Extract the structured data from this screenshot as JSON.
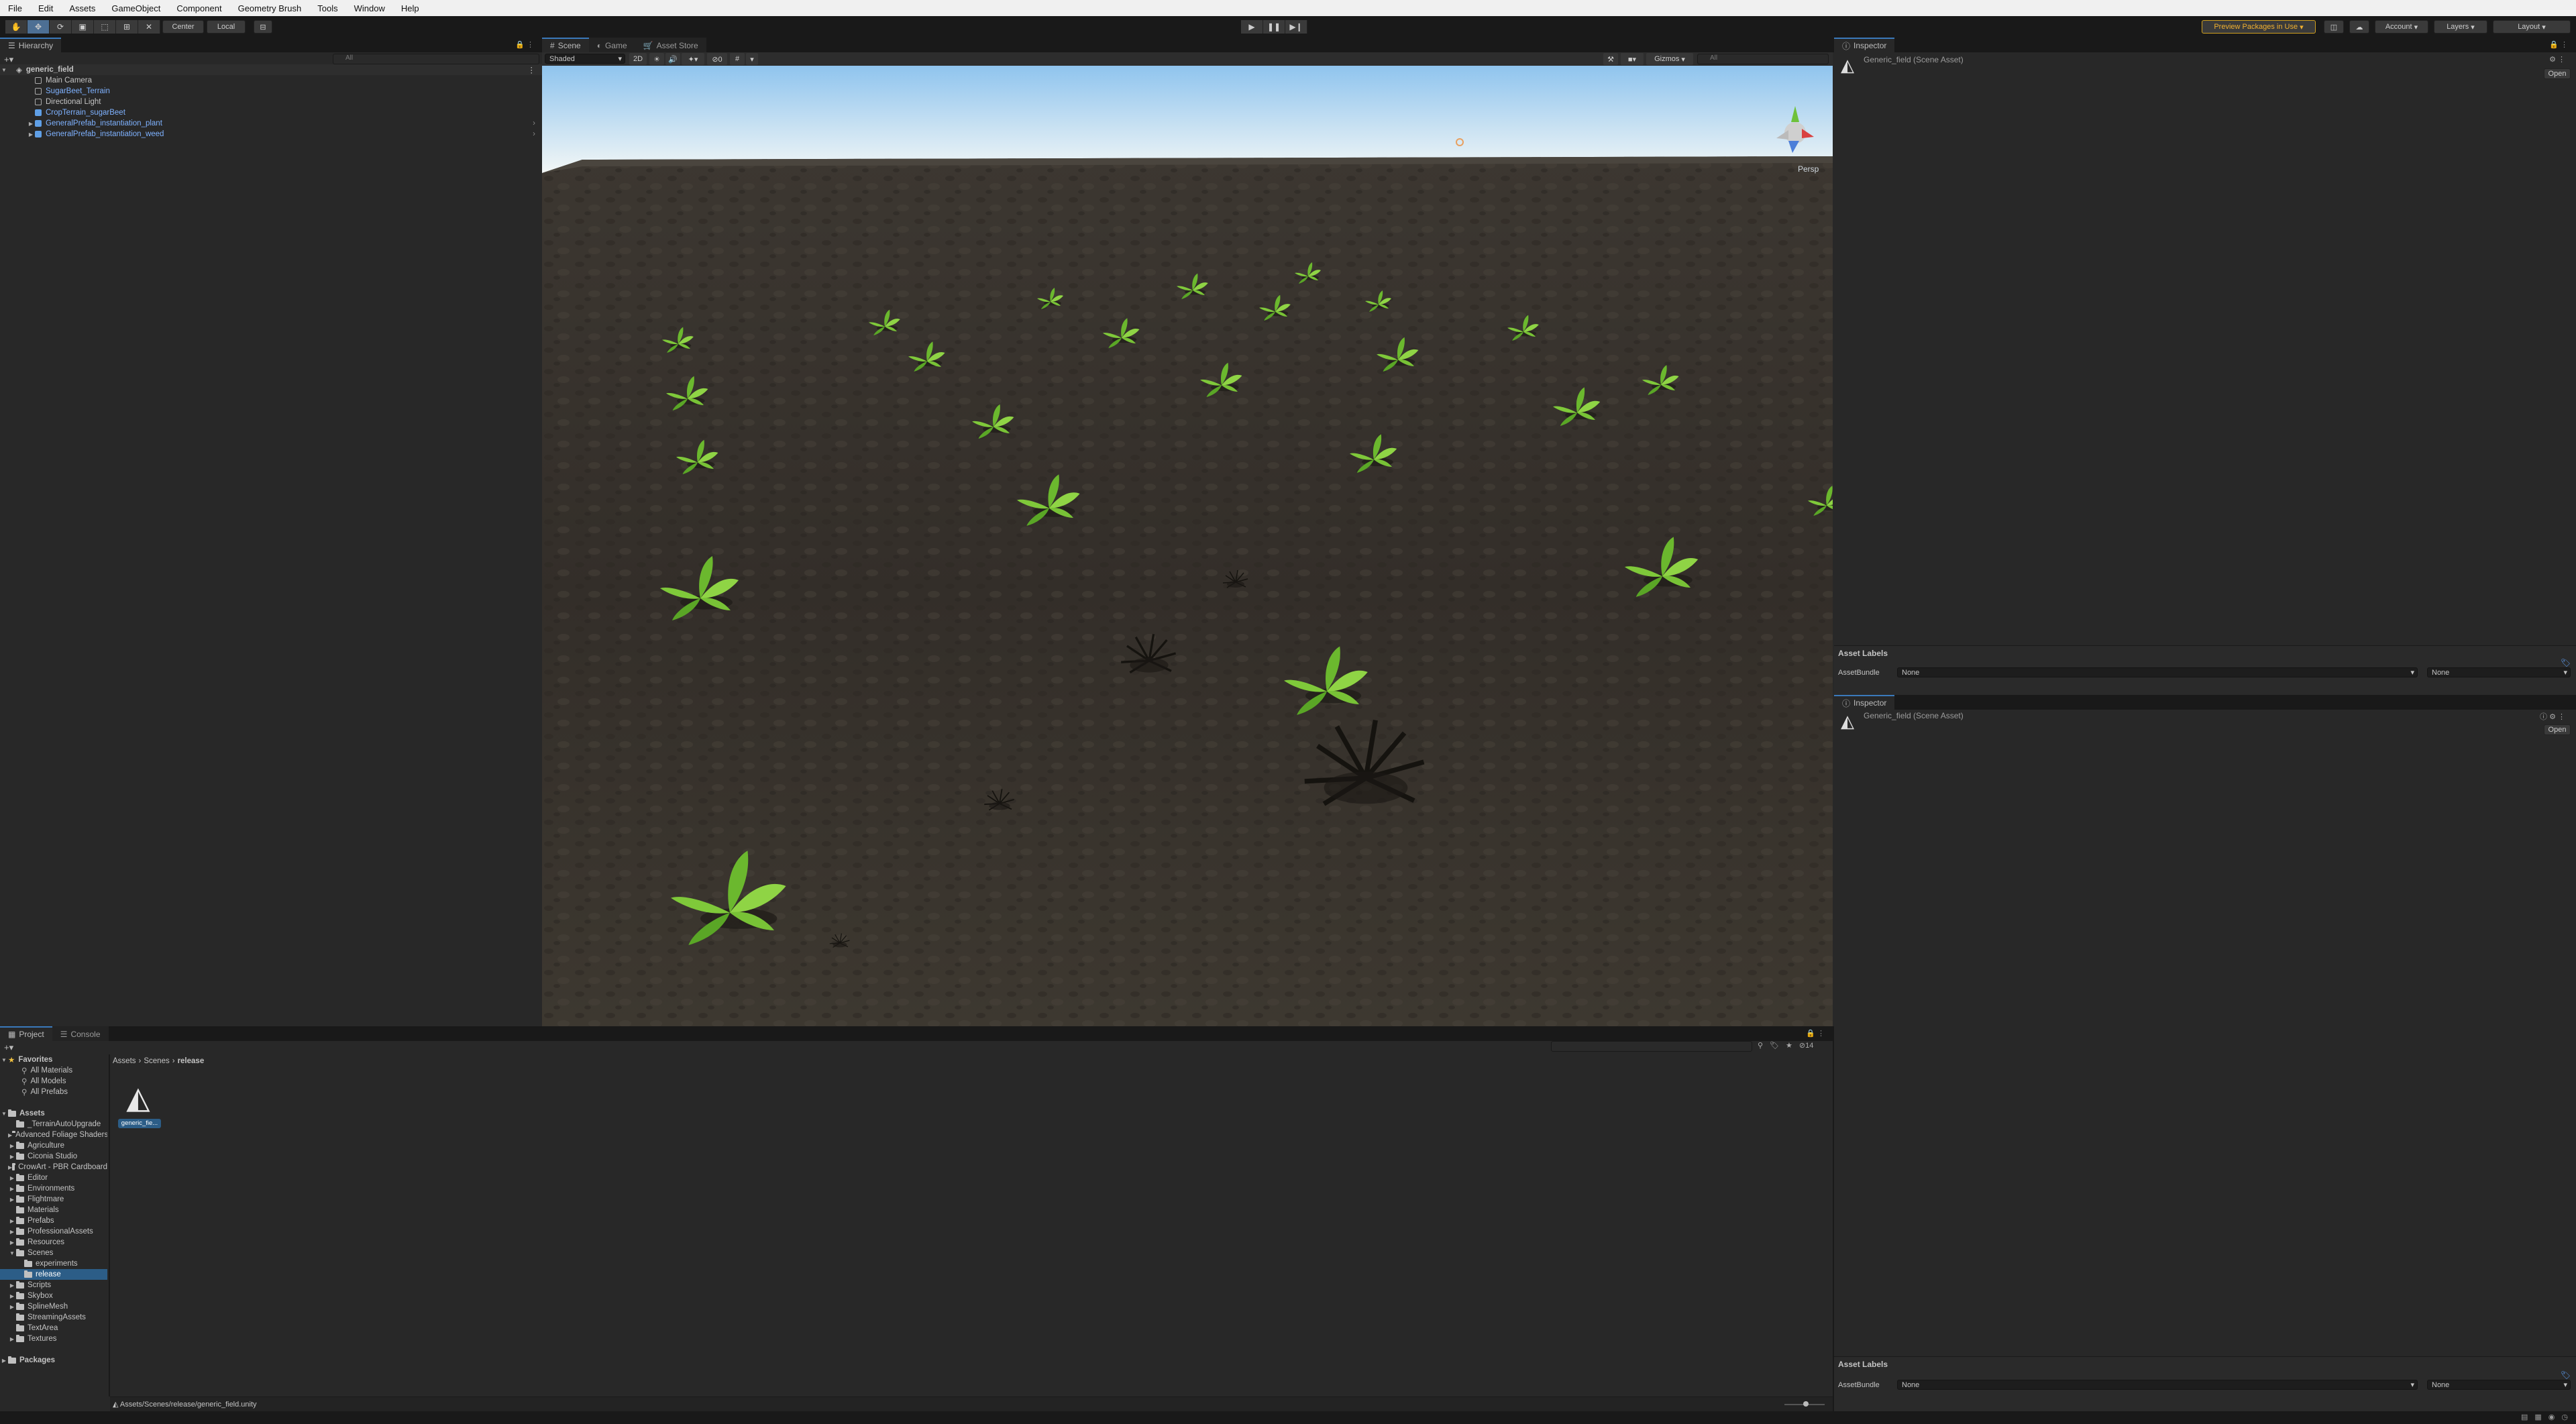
{
  "menubar": [
    "File",
    "Edit",
    "Assets",
    "GameObject",
    "Component",
    "Geometry Brush",
    "Tools",
    "Window",
    "Help"
  ],
  "toolbar": {
    "pivot": "Center",
    "space": "Local",
    "preview_packages": "Preview Packages in Use",
    "account": "Account",
    "layers": "Layers",
    "layout": "Layout"
  },
  "hierarchy": {
    "tab": "Hierarchy",
    "search_placeholder": "All",
    "scene": "generic_field",
    "items": [
      {
        "label": "Main Camera",
        "kind": "gameobject",
        "expandable": false,
        "prefab": false
      },
      {
        "label": "SugarBeet_Terrain",
        "kind": "gameobject",
        "expandable": false,
        "prefab": true
      },
      {
        "label": "Directional Light",
        "kind": "gameobject",
        "expandable": false,
        "prefab": false
      },
      {
        "label": "CropTerrain_sugarBeet",
        "kind": "prefab",
        "expandable": false,
        "prefab": true
      },
      {
        "label": "GeneralPrefab_instantiation_plant",
        "kind": "prefab",
        "expandable": true,
        "prefab": true
      },
      {
        "label": "GeneralPrefab_instantiation_weed",
        "kind": "prefab",
        "expandable": true,
        "prefab": true
      }
    ]
  },
  "scene_view": {
    "tabs": [
      "Scene",
      "Game",
      "Asset Store"
    ],
    "shading_mode": "Shaded",
    "mode_2d": "2D",
    "gizmos": "Gizmos",
    "search_placeholder": "All",
    "persp_label": "Persp"
  },
  "inspector_top": {
    "tab": "Inspector",
    "asset_title": "Generic_field (Scene Asset)",
    "open_label": "Open",
    "asset_labels": "Asset Labels",
    "assetbundle_label": "AssetBundle",
    "assetbundle_value": "None",
    "variant_value": "None"
  },
  "inspector_bottom": {
    "tab": "Inspector",
    "asset_title": "Generic_field (Scene Asset)",
    "open_label": "Open",
    "asset_labels": "Asset Labels",
    "assetbundle_label": "AssetBundle",
    "assetbundle_value": "None",
    "variant_value": "None"
  },
  "project": {
    "tabs": [
      "Project",
      "Console"
    ],
    "count_badge": "14",
    "favorites_label": "Favorites",
    "favorites": [
      "All Materials",
      "All Models",
      "All Prefabs"
    ],
    "assets_label": "Assets",
    "tree": [
      {
        "label": "_TerrainAutoUpgrade",
        "depth": 1,
        "arrow": ""
      },
      {
        "label": "Advanced Foliage Shaders",
        "depth": 1,
        "arrow": "▶"
      },
      {
        "label": "Agriculture",
        "depth": 1,
        "arrow": "▶"
      },
      {
        "label": "Ciconia Studio",
        "depth": 1,
        "arrow": "▶"
      },
      {
        "label": "CrowArt - PBR Cardboard",
        "depth": 1,
        "arrow": "▶"
      },
      {
        "label": "Editor",
        "depth": 1,
        "arrow": "▶"
      },
      {
        "label": "Environments",
        "depth": 1,
        "arrow": "▶"
      },
      {
        "label": "Flightmare",
        "depth": 1,
        "arrow": "▶"
      },
      {
        "label": "Materials",
        "depth": 1,
        "arrow": ""
      },
      {
        "label": "Prefabs",
        "depth": 1,
        "arrow": "▶"
      },
      {
        "label": "ProfessionalAssets",
        "depth": 1,
        "arrow": "▶"
      },
      {
        "label": "Resources",
        "depth": 1,
        "arrow": "▶"
      },
      {
        "label": "Scenes",
        "depth": 1,
        "arrow": "▼"
      },
      {
        "label": "experiments",
        "depth": 2,
        "arrow": ""
      },
      {
        "label": "release",
        "depth": 2,
        "arrow": "",
        "selected": true
      },
      {
        "label": "Scripts",
        "depth": 1,
        "arrow": "▶"
      },
      {
        "label": "Skybox",
        "depth": 1,
        "arrow": "▶"
      },
      {
        "label": "SplineMesh",
        "depth": 1,
        "arrow": "▶"
      },
      {
        "label": "StreamingAssets",
        "depth": 1,
        "arrow": ""
      },
      {
        "label": "TextArea",
        "depth": 1,
        "arrow": ""
      },
      {
        "label": "Textures",
        "depth": 1,
        "arrow": "▶"
      }
    ],
    "packages_label": "Packages",
    "breadcrumb": [
      "Assets",
      "Scenes",
      "release"
    ],
    "file_label": "generic_fie...",
    "status_path": "Assets/Scenes/release/generic_field.unity"
  },
  "colors": {
    "accent": "#3a79bb",
    "panel": "#282828",
    "prefab_blue": "#7fb2ff",
    "selection": "#2c5d87"
  }
}
